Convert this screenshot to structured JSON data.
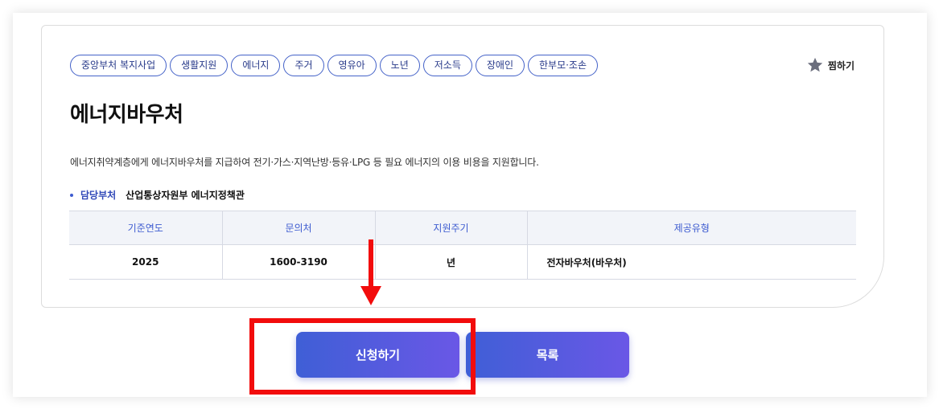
{
  "tags": [
    "중앙부처 복지사업",
    "생활지원",
    "에너지",
    "주거",
    "영유아",
    "노년",
    "저소득",
    "장애인",
    "한부모·조손"
  ],
  "favorite": {
    "label": "찜하기",
    "icon": "star-icon",
    "icon_color": "#6b6e7d"
  },
  "title": "에너지바우처",
  "description": "에너지취약계층에게 에너지바우처를 지급하여 전기·가스·지역난방·등유·LPG 등 필요 에너지의 이용 비용을 지원합니다.",
  "department": {
    "label": "담당부처",
    "value": "산업통상자원부 에너지정책관"
  },
  "info_table": {
    "headers": [
      "기준연도",
      "문의처",
      "지원주기",
      "제공유형"
    ],
    "row": [
      "2025",
      "1600-3190",
      "년",
      "전자바우처(바우처)"
    ]
  },
  "buttons": {
    "apply": "신청하기",
    "list": "목록"
  },
  "colors": {
    "accent": "#3d5bd0",
    "gradient_end": "#6a57e6",
    "annotation_red": "#f20c0c"
  }
}
